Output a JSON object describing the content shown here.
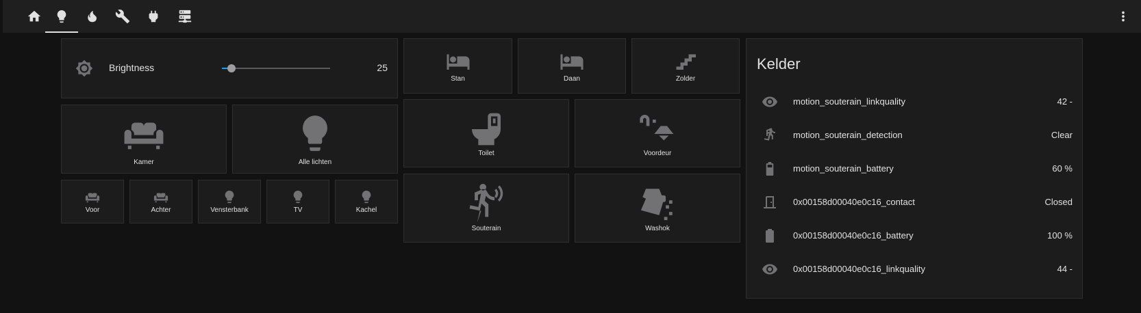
{
  "colors": {
    "background": "#121212",
    "card": "#1c1c1c",
    "icon": "#727275",
    "accent": "#03a9f4",
    "text": "#e1e1e1"
  },
  "topbar": {
    "tabs": [
      {
        "icon": "home-icon",
        "active": false
      },
      {
        "icon": "lightbulb-icon",
        "active": true
      },
      {
        "icon": "fire-icon",
        "active": false
      },
      {
        "icon": "wrench-icon",
        "active": false
      },
      {
        "icon": "power-plug-icon",
        "active": false
      },
      {
        "icon": "server-network-icon",
        "active": false
      }
    ],
    "menu_icon": "dots-vertical-icon"
  },
  "brightness": {
    "icon": "brightness-icon",
    "label": "Brightness",
    "value": "25",
    "slider_fraction": 0.09
  },
  "lights": {
    "big": [
      {
        "label": "Kamer",
        "icon": "sofa-icon"
      },
      {
        "label": "Alle lichten",
        "icon": "lightbulb-icon"
      }
    ],
    "small": [
      {
        "label": "Voor",
        "icon": "sofa-icon"
      },
      {
        "label": "Achter",
        "icon": "sofa-icon"
      },
      {
        "label": "Vensterbank",
        "icon": "lightbulb-icon"
      },
      {
        "label": "TV",
        "icon": "lightbulb-icon"
      },
      {
        "label": "Kachel",
        "icon": "lightbulb-icon"
      }
    ]
  },
  "rooms": {
    "top": [
      {
        "label": "Stan",
        "icon": "bed-icon"
      },
      {
        "label": "Daan",
        "icon": "bed-icon"
      },
      {
        "label": "Zolder",
        "icon": "stairs-icon"
      }
    ],
    "middle": [
      {
        "label": "Toilet",
        "icon": "toilet-icon"
      },
      {
        "label": "Voordeur",
        "icon": "outdoor-lamp-icon"
      }
    ],
    "bottom": [
      {
        "label": "Souterain",
        "icon": "motion-sensor-icon"
      },
      {
        "label": "Washok",
        "icon": "washing-bucket-icon"
      }
    ]
  },
  "kelder": {
    "title": "Kelder",
    "entities": [
      {
        "icon": "eye-icon",
        "name": "motion_souterain_linkquality",
        "state": "42 -"
      },
      {
        "icon": "walk-icon",
        "name": "motion_souterain_detection",
        "state": "Clear"
      },
      {
        "icon": "battery-60-icon",
        "name": "motion_souterain_battery",
        "state": "60 %"
      },
      {
        "icon": "door-icon",
        "name": "0x00158d00040e0c16_contact",
        "state": "Closed"
      },
      {
        "icon": "battery-full-icon",
        "name": "0x00158d00040e0c16_battery",
        "state": "100 %"
      },
      {
        "icon": "eye-icon",
        "name": "0x00158d00040e0c16_linkquality",
        "state": "44 -"
      }
    ]
  }
}
